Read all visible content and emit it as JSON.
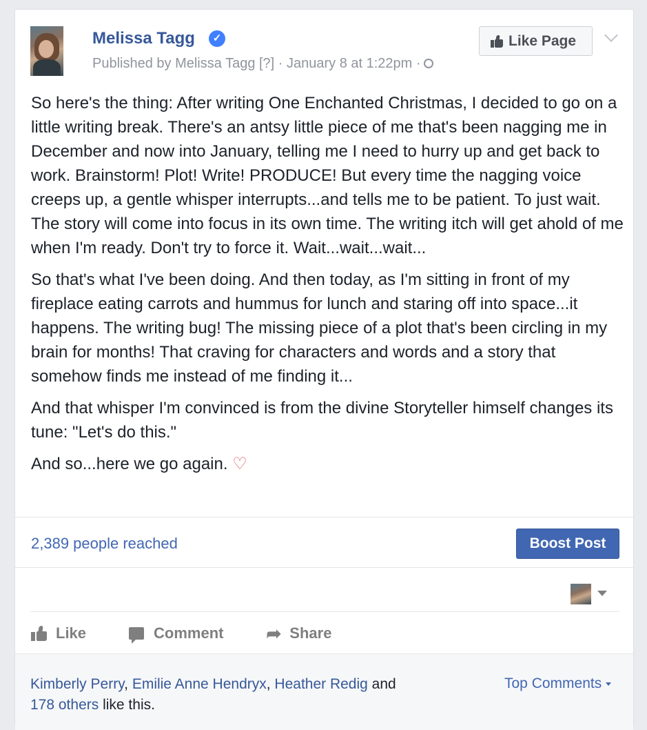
{
  "post": {
    "author": "Melissa Tagg",
    "meta": "Published by Melissa Tagg [?] · January 8 at 1:22pm ·",
    "like_page_label": "Like Page",
    "paragraphs": [
      "So here's the thing: After writing One Enchanted Christmas, I decided to go on a little writing break. There's an antsy little piece of me that's been nagging me in December and now into January, telling me I need to hurry up and get back to work. Brainstorm! Plot! Write! PRODUCE! But every time the nagging voice creeps up, a gentle whisper interrupts...and tells me to be patient. To just wait. The story will come into focus in its own time. The writing itch will get ahold of me when I'm ready. Don't try to force it. Wait...wait...wait...",
      "So that's what I've been doing. And then today, as I'm sitting in front of my fireplace eating carrots and hummus for lunch and staring off into space...it happens. The writing bug! The missing piece of a plot that's been circling in my brain for months! That craving for characters and words and a story that somehow finds me instead of me finding it...",
      "And that whisper I'm convinced is from the divine Storyteller himself changes its tune: \"Let's do this.\""
    ],
    "last_line": "And so...here we go again.",
    "heart": "♡"
  },
  "insights": {
    "reach": "2,389 people reached",
    "boost_label": "Boost Post"
  },
  "actions": {
    "like": "Like",
    "comment": "Comment",
    "share": "Share"
  },
  "likes": {
    "names": [
      "Kimberly Perry",
      "Emilie Anne Hendryx",
      "Heather Redig"
    ],
    "sep1": ", ",
    "sep2": ", ",
    "and": " and",
    "others": "178 others",
    "suffix": " like this.",
    "top_comments": "Top Comments"
  },
  "colors": {
    "link": "#365899",
    "accent": "#4267b2",
    "muted": "#90949c"
  }
}
